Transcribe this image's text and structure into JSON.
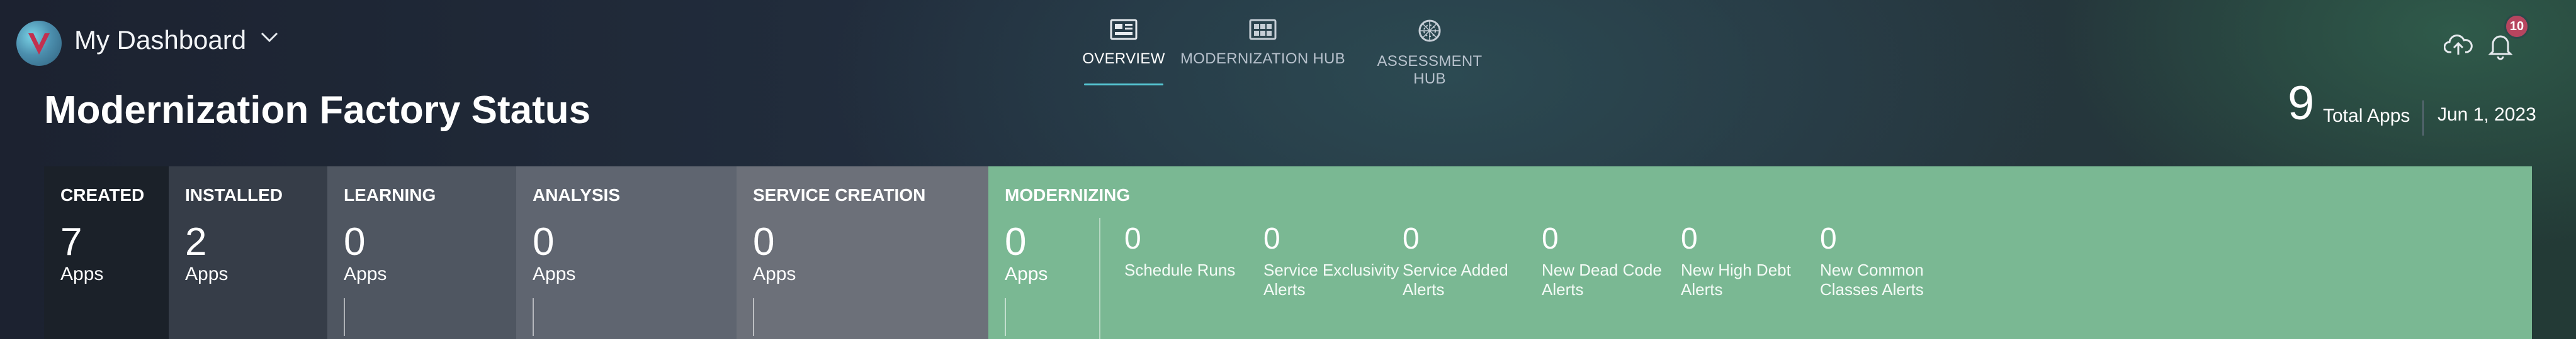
{
  "header": {
    "dashboard_title": "My Dashboard",
    "logo_letter": "V",
    "icons": [
      "chevron-down-icon",
      "overview-icon",
      "modernization-hub-icon",
      "assessment-hub-icon",
      "cloud-upload-icon",
      "bell-icon"
    ],
    "notification_count": "10",
    "tabs": [
      {
        "label": "OVERVIEW",
        "active": true
      },
      {
        "label": "MODERNIZATION HUB",
        "active": false
      },
      {
        "label": "ASSESSMENT HUB",
        "active": false
      }
    ]
  },
  "page": {
    "title": "Modernization Factory Status",
    "total_apps_count": "9",
    "total_apps_label": "Total Apps",
    "date": "Jun 1, 2023"
  },
  "stages": [
    {
      "name": "CREATED",
      "count": "7",
      "unit": "Apps",
      "color": "#1b2129"
    },
    {
      "name": "INSTALLED",
      "count": "2",
      "unit": "Apps",
      "color": "#363d48"
    },
    {
      "name": "LEARNING",
      "count": "0",
      "unit": "Apps",
      "color": "#4f5661"
    },
    {
      "name": "ANALYSIS",
      "count": "0",
      "unit": "Apps",
      "color": "#5f6570"
    },
    {
      "name": "SERVICE CREATION",
      "count": "0",
      "unit": "Apps",
      "color": "#6c7079"
    },
    {
      "name": "MODERNIZING",
      "count": "0",
      "unit": "Apps",
      "color": "#7ab893"
    }
  ],
  "modernizing_metrics": [
    {
      "count": "0",
      "label": "Schedule Runs"
    },
    {
      "count": "0",
      "label": "Service Exclusivity Alerts"
    },
    {
      "count": "0",
      "label": "Service Added Alerts"
    },
    {
      "count": "0",
      "label": "New Dead Code Alerts"
    },
    {
      "count": "0",
      "label": "New High Debt Alerts"
    },
    {
      "count": "0",
      "label": "New Common Classes Alerts"
    }
  ],
  "colors": {
    "accent_underline": "#56c6d3",
    "badge": "#b7455f",
    "modernizing": "#7ab893"
  }
}
